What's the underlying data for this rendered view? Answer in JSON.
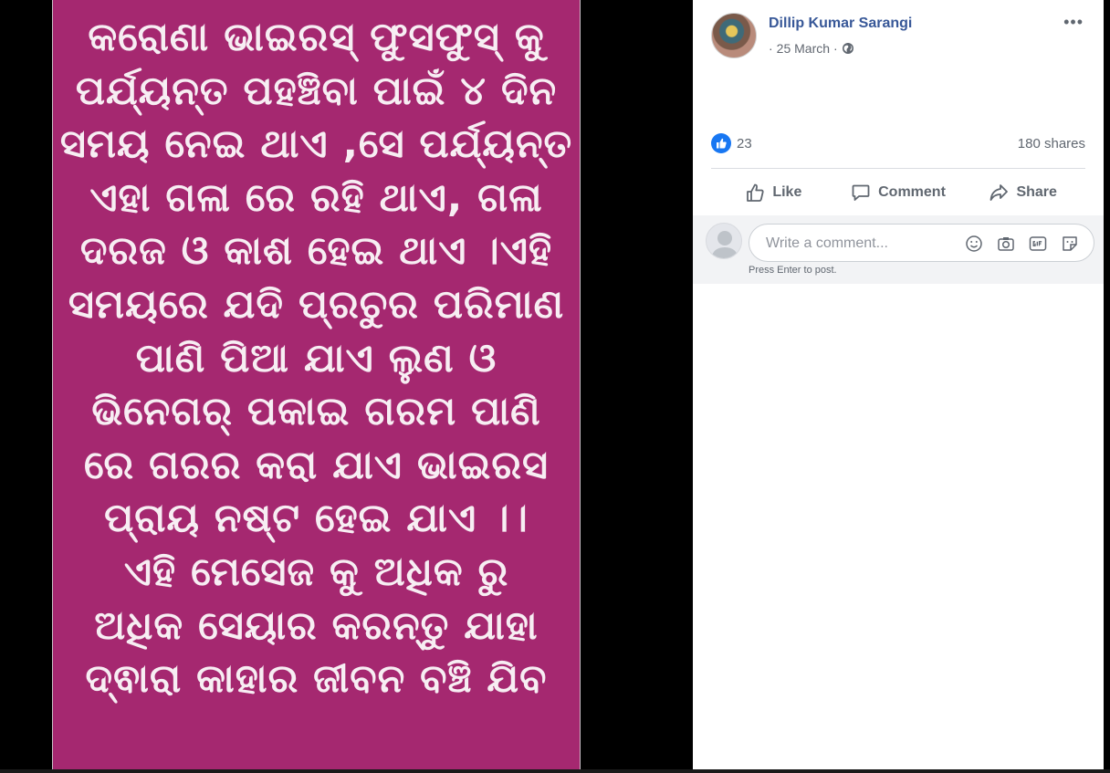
{
  "post_image": {
    "background_color": "#a52870",
    "text_color": "#f7eef3",
    "lines": [
      "କରୋଣା ଭାଇରସ୍ ଫୁସଫୁସ୍ କୁ",
      "ପର୍ଯ୍ୟନ୍ତ ପହଞ୍ଚିବା ପାଇଁ ୪ ଦିନ",
      "ସମୟ ନେଇ ଥାଏ ,ସେ ପର୍ଯ୍ୟନ୍ତ",
      "ଏହା ଗଳା ରେ ରହି ଥାଏ, ଗଳା",
      "ଦରଜ ଓ କାଶ ହେଇ ଥାଏ ।ଏହି",
      "ସମୟରେ ଯଦି ପ୍ରଚୁର ପରିମାଣ",
      "ପାଣି ପିଆ ଯାଏ ଲୁଣ ଓ",
      "ଭିନେଗର୍ ପକାଇ ଗରମ ପାଣି",
      "ରେ ଗରର କରା ଯାଏ ଭାଇରସ",
      "ପ୍ରାୟ ନଷ୍ଟ ହେଇ ଯାଏ ।।",
      "ଏହି ମେସେଜ କୁ ଅଧିକ ରୁ",
      "ଅଧିକ ସେୟାର କରନ୍ତୁ ଯାହା",
      "ଦ୍ଵାରା କାହାର ଜୀବନ ବଞ୍ଚି ଯିବ"
    ]
  },
  "post": {
    "author_name": "Dillip Kumar Sarangi",
    "date": "25 March",
    "privacy_icon": "globe-icon",
    "more_icon": "more-options-icon",
    "more_label": "•••",
    "reaction_count": "23",
    "reaction_icon": "like-reaction-icon",
    "shares": "180 shares",
    "actions": {
      "like": "Like",
      "comment": "Comment",
      "share": "Share"
    }
  },
  "comment": {
    "placeholder": "Write a comment...",
    "hint": "Press Enter to post.",
    "tools": [
      "emoji-icon",
      "camera-icon",
      "gif-icon",
      "sticker-icon"
    ]
  },
  "colors": {
    "link_blue": "#385898",
    "like_blue": "#1877f2",
    "meta_grey": "#606770"
  }
}
